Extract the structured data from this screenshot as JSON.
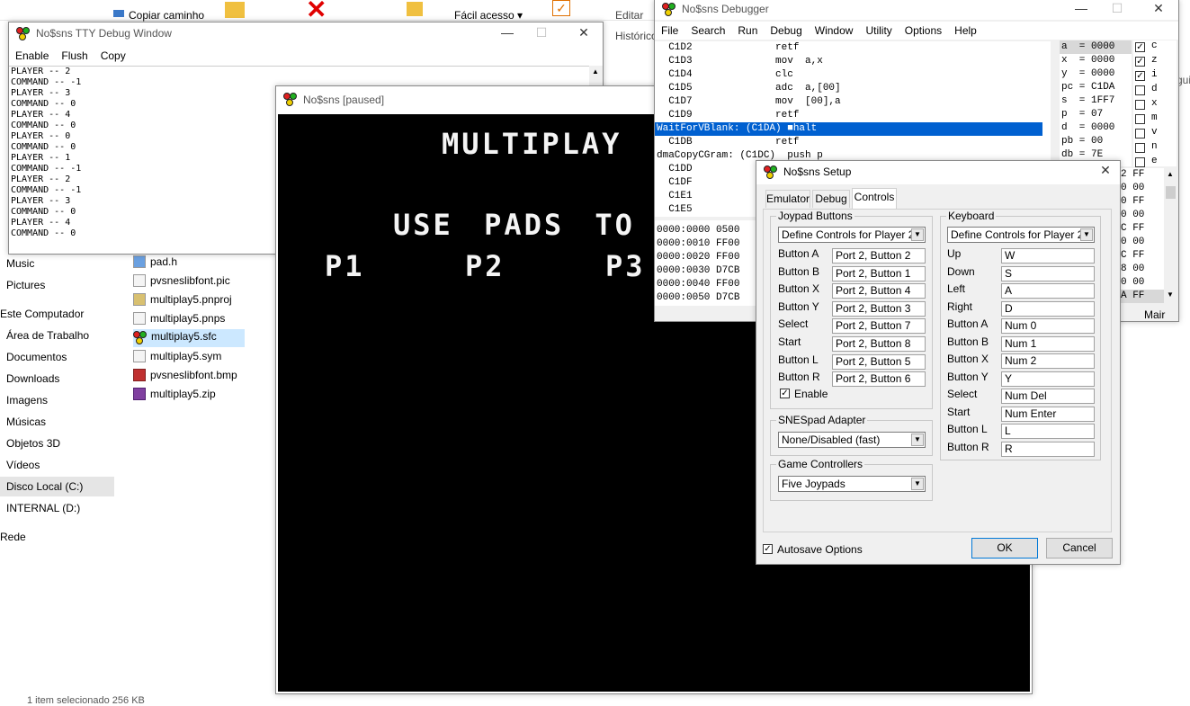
{
  "explorer": {
    "ribbon": {
      "copy_path": "Copiar caminho",
      "easy_access": "Fácil acesso ▾",
      "edit": "Editar",
      "history": "Histórico"
    },
    "nav": [
      "Music",
      "Pictures",
      "Este Computador",
      "Área de Trabalho",
      "Documentos",
      "Downloads",
      "Imagens",
      "Músicas",
      "Objetos 3D",
      "Vídeos",
      "Disco Local (C:)",
      "INTERNAL (D:)",
      "Rede"
    ],
    "files": [
      "pad.h",
      "pvsneslibfont.pic",
      "multiplay5.pnproj",
      "multiplay5.pnps",
      "multiplay5.sfc",
      "multiplay5.sym",
      "pvsneslibfont.bmp",
      "multiplay5.zip"
    ],
    "status": "1 item selecionado  256 KB",
    "right_edge": "gui"
  },
  "tty": {
    "title": "No$sns TTY Debug Window",
    "menu": [
      "Enable",
      "Flush",
      "Copy"
    ],
    "lines": [
      "PLAYER -- 2",
      "COMMAND -- -1",
      "PLAYER -- 3",
      "COMMAND -- 0",
      "PLAYER -- 4",
      "COMMAND -- 0",
      "PLAYER -- 0",
      "COMMAND -- 0",
      "PLAYER -- 1",
      "COMMAND -- -1",
      "PLAYER -- 2",
      "COMMAND -- -1",
      "PLAYER -- 3",
      "COMMAND -- 0",
      "PLAYER -- 4",
      "COMMAND -- 0"
    ]
  },
  "game": {
    "title": "No$sns [paused]",
    "line1": "MULTIPLAY",
    "line2": "USE PADS TO",
    "p1": "P1",
    "p2": "P2",
    "p3": "P3"
  },
  "debugger": {
    "title": "No$sns Debugger",
    "menu": [
      "File",
      "Search",
      "Run",
      "Debug",
      "Window",
      "Utility",
      "Options",
      "Help"
    ],
    "code": [
      "  C1D2              retf",
      "  C1D3              mov  a,x",
      "  C1D4              clc",
      "  C1D5              adc  a,[00]",
      "  C1D7              mov  [00],a",
      "  C1D9              retf",
      "WaitForVBlank: (C1DA) ■halt",
      "  C1DB              retf",
      "dmaCopyCGram: (C1DC)  push p",
      "  C1DD",
      "  C1DF",
      "  C1E1",
      "  C1E5"
    ],
    "highlight_index": 6,
    "regs": [
      "a  = 0000",
      "x  = 0000",
      "y  = 0000",
      "pc = C1DA",
      "s  = 1FF7",
      "p  = 07",
      "d  = 0000",
      "pb = 00",
      "db = 7E"
    ],
    "flags": [
      {
        "name": "c",
        "on": true
      },
      {
        "name": "z",
        "on": true
      },
      {
        "name": "i",
        "on": true
      },
      {
        "name": "d",
        "on": false
      },
      {
        "name": "x",
        "on": false
      },
      {
        "name": "m",
        "on": false
      },
      {
        "name": "v",
        "on": false
      },
      {
        "name": "n",
        "on": false
      },
      {
        "name": "e",
        "on": false
      }
    ],
    "memory": [
      "0000:0000 0500",
      "0000:0010 FF00",
      "0000:0020 FF00",
      "0000:0030 D7CB",
      "0000:0040 FF00",
      "0000:0050 D7CB"
    ],
    "stack": [
      "2 FF",
      "0 00",
      "0 FF",
      "0 00",
      "C FF",
      "0 00",
      "C FF",
      "8 00",
      "0 00",
      "A FF",
      "0 00"
    ],
    "main_label": "Mair"
  },
  "setup": {
    "title": "No$sns Setup",
    "tabs": [
      "Emulator",
      "Debug",
      "Controls"
    ],
    "joypad": {
      "legend": "Joypad Buttons",
      "define": "Define Controls for Player  2",
      "rows": [
        {
          "label": "Button A",
          "value": "Port 2, Button 2"
        },
        {
          "label": "Button B",
          "value": "Port 2, Button 1"
        },
        {
          "label": "Button X",
          "value": "Port 2, Button 4"
        },
        {
          "label": "Button Y",
          "value": "Port 2, Button 3"
        },
        {
          "label": "Select",
          "value": "Port 2, Button 7"
        },
        {
          "label": "Start",
          "value": "Port 2, Button 8"
        },
        {
          "label": "Button L",
          "value": "Port 2, Button 5"
        },
        {
          "label": "Button R",
          "value": "Port 2, Button 6"
        }
      ],
      "enable": "Enable"
    },
    "keyboard": {
      "legend": "Keyboard",
      "define": "Define Controls for Player  2",
      "rows": [
        {
          "label": "Up",
          "value": "W"
        },
        {
          "label": "Down",
          "value": "S"
        },
        {
          "label": "Left",
          "value": "A"
        },
        {
          "label": "Right",
          "value": "D"
        },
        {
          "label": "Button A",
          "value": "Num 0"
        },
        {
          "label": "Button B",
          "value": "Num 1"
        },
        {
          "label": "Button X",
          "value": "Num 2"
        },
        {
          "label": "Button Y",
          "value": "Y"
        },
        {
          "label": "Select",
          "value": "Num Del"
        },
        {
          "label": "Start",
          "value": "Num Enter"
        },
        {
          "label": "Button L",
          "value": "L"
        },
        {
          "label": "Button R",
          "value": "R"
        }
      ]
    },
    "snespad": {
      "legend": "SNESpad Adapter",
      "value": "None/Disabled (fast)"
    },
    "gamectl": {
      "legend": "Game Controllers",
      "value": "Five Joypads"
    },
    "autosave": "Autosave Options",
    "ok": "OK",
    "cancel": "Cancel"
  }
}
